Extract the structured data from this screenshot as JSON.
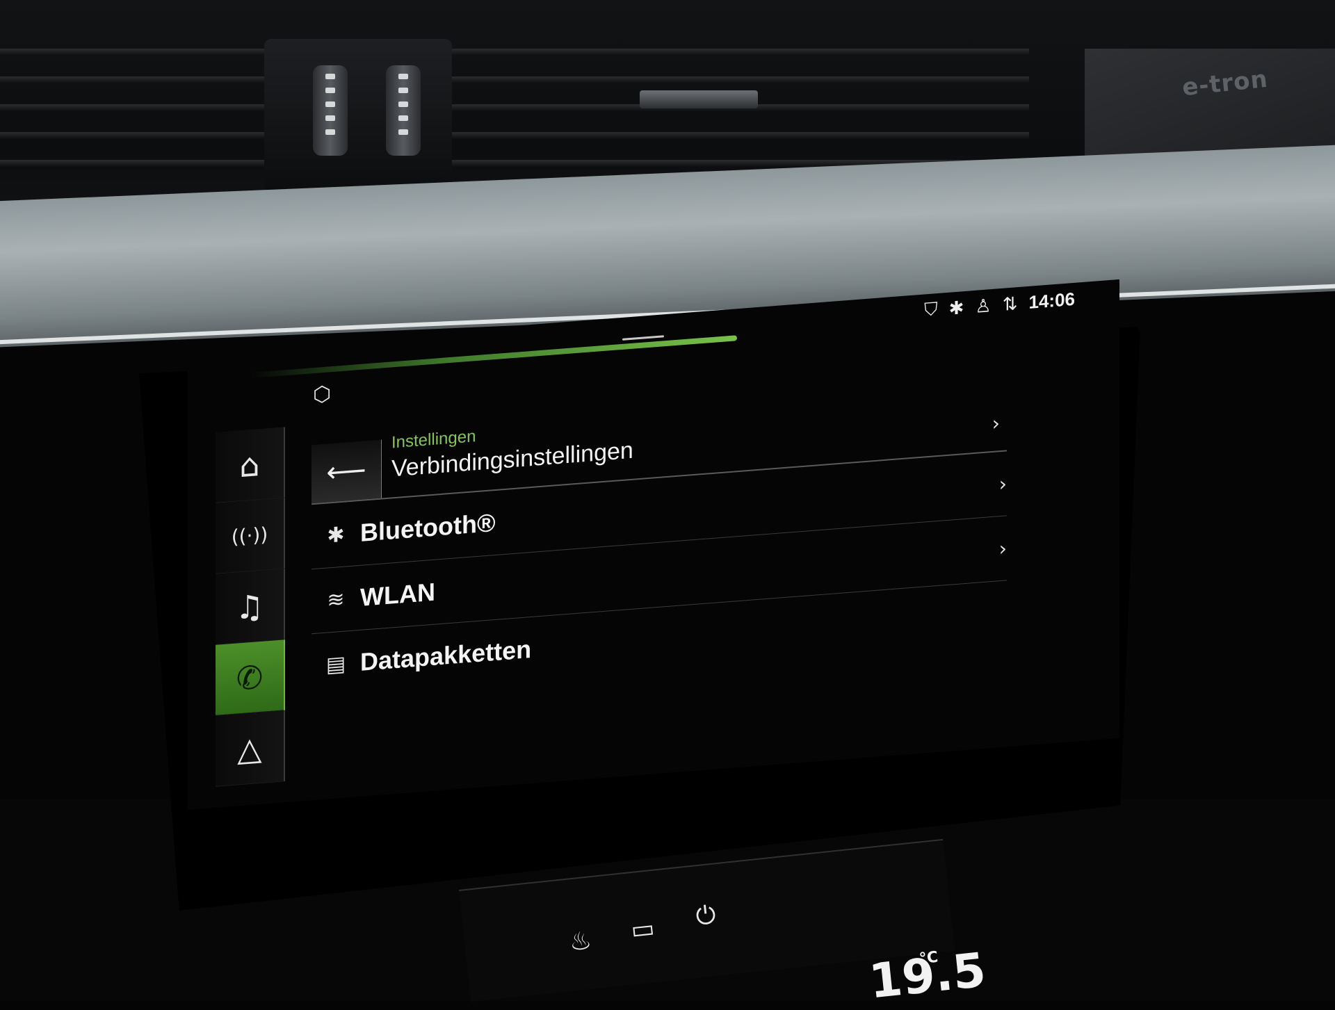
{
  "dashboard": {
    "badge": "e-tron",
    "temperature": "19.5",
    "temperature_unit": "°C"
  },
  "status_bar": {
    "icons": [
      "location-shield-icon",
      "bluetooth-icon",
      "user-icon",
      "lte-icon"
    ],
    "time": "14:06"
  },
  "sidebar": {
    "items": [
      {
        "name": "home",
        "glyph": "⌂",
        "active": false
      },
      {
        "name": "radio",
        "glyph": "((·))",
        "active": false
      },
      {
        "name": "media",
        "glyph": "♫",
        "active": false
      },
      {
        "name": "phone",
        "glyph": "✆",
        "active": true
      },
      {
        "name": "navigation",
        "glyph": "△",
        "active": false
      }
    ]
  },
  "header": {
    "breadcrumb": "Instellingen",
    "title": "Verbindingsinstellingen",
    "back_glyph": "⟵"
  },
  "list": {
    "items": [
      {
        "label": "Bluetooth®",
        "icon": "bluetooth-icon",
        "glyph": "✱",
        "has_chevron": true
      },
      {
        "label": "WLAN",
        "icon": "wifi-icon",
        "glyph": "≋",
        "has_chevron": true
      },
      {
        "label": "Datapakketten",
        "icon": "data-package-icon",
        "glyph": "▤",
        "has_chevron": false
      }
    ]
  },
  "colors": {
    "accent": "#79c24a",
    "active_tab": "#3f7f22",
    "background": "#050505"
  }
}
